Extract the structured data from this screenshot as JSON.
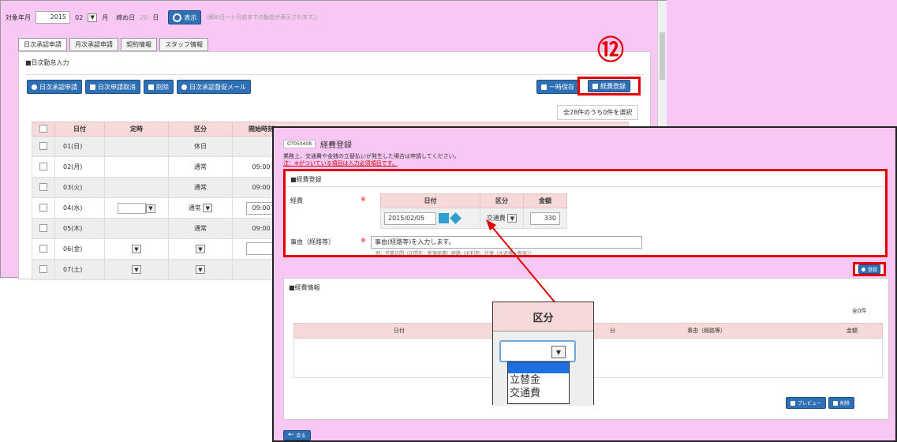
{
  "top": {
    "target_label": "対象年月",
    "year": "2015",
    "month": "02",
    "month_unit": "月",
    "closing_label": "締め日",
    "closing_day": "28",
    "day_unit": "日",
    "show_button": "表示",
    "note": "(締め日一ヶ月前までの勤怠が表示されます。)"
  },
  "tabs": [
    "日次承認申請",
    "月次承認申請",
    "契約情報",
    "スタッフ情報"
  ],
  "daily": {
    "section_title": "■日次勤怠入力",
    "actions": [
      "日次承認申請",
      "日次申請取消",
      "削除",
      "日次承認督促メール"
    ],
    "temp_save": "一時保存",
    "expense_register": "経費登録",
    "step_number": "⑫",
    "selection_count": "全28件のうち0件を選択",
    "headers": [
      "日付",
      "定時",
      "区分",
      "開始時刻"
    ],
    "rows": [
      {
        "date": "01(日)",
        "kubun": "休日",
        "start": ""
      },
      {
        "date": "02(月)",
        "kubun": "通常",
        "start": "09:00"
      },
      {
        "date": "03(火)",
        "kubun": "通常",
        "start": "09:00"
      },
      {
        "date": "04(水)",
        "kubun": "通常",
        "start": "09:00"
      },
      {
        "date": "05(木)",
        "kubun": "通常",
        "start": "09:00"
      },
      {
        "date": "06(金)",
        "kubun": "",
        "start": ""
      },
      {
        "date": "07(土)",
        "kubun": "",
        "start": ""
      }
    ]
  },
  "modal": {
    "code": "GT050408",
    "title": "経費登録",
    "desc1": "業務上、交通費や金銭の立替払いが発生した場合は申請してください。",
    "desc2": "注：※がついている項目は入力必須項目です。",
    "section1": "■経費登録",
    "expense_label": "経費",
    "required_mark": "※",
    "col_date": "日付",
    "col_kubun": "区分",
    "col_amount": "金額",
    "date_value": "2015/02/05",
    "kubun_value": "交通費",
    "amount_value": "330",
    "reason_label": "事由（経路等）",
    "reason_placeholder": "事由(経路等)を入力します。",
    "reason_example": "例：営業訪問（訪問先：新宿商事）経路（JR利用：往復（水道橋～新宿））",
    "register_button": "登録",
    "section2": "■経費情報",
    "info_count": "全0件",
    "info_col_date": "日付",
    "info_col_kubun": "分",
    "info_col_reason": "事由（経路等）",
    "info_col_amount": "金額",
    "preview_button": "プレビュー",
    "delete_button": "削除",
    "back_button": "戻る"
  },
  "zoom": {
    "title": "区分",
    "options": [
      "",
      "立替金",
      "交通費"
    ]
  },
  "colors": {
    "pink": "#f9c7f4",
    "highlight": "#e00000",
    "button_blue": "#2f6fb4"
  }
}
